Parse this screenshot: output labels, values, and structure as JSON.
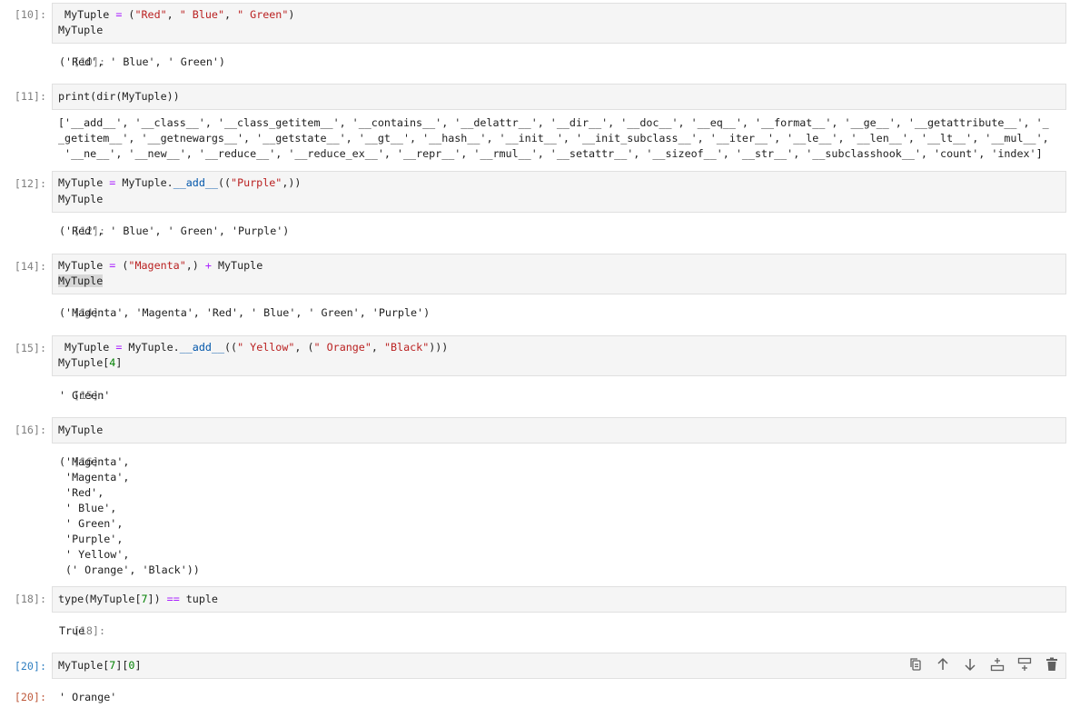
{
  "cells": [
    {
      "in_prompt": "[10]:",
      "code": [
        " MyTuple = (\"Red\", \" Blue\", \" Green\")",
        "MyTuple"
      ],
      "out_prompt": "[10]:",
      "output": [
        "('Red', ' Blue', ' Green')"
      ]
    },
    {
      "in_prompt": "[11]:",
      "code": [
        "print(dir(MyTuple))"
      ],
      "output": [
        "['__add__', '__class__', '__class_getitem__', '__contains__', '__delattr__', '__dir__', '__doc__', '__eq__', '__format__', '__ge__', '__getattribute__', '_",
        "_getitem__', '__getnewargs__', '__getstate__', '__gt__', '__hash__', '__init__', '__init_subclass__', '__iter__', '__le__', '__len__', '__lt__', '__mul__',",
        " '__ne__', '__new__', '__reduce__', '__reduce_ex__', '__repr__', '__rmul__', '__setattr__', '__sizeof__', '__str__', '__subclasshook__', 'count', 'index']"
      ]
    },
    {
      "in_prompt": "[12]:",
      "code": [
        "MyTuple = MyTuple.__add__((\"Purple\",))",
        "MyTuple"
      ],
      "out_prompt": "[12]:",
      "output": [
        "('Red', ' Blue', ' Green', 'Purple')"
      ]
    },
    {
      "in_prompt": "[14]:",
      "code": [
        "MyTuple = (\"Magenta\",) + MyTuple",
        "MyTuple"
      ],
      "out_prompt": "[14]:",
      "output": [
        "('Magenta', 'Magenta', 'Red', ' Blue', ' Green', 'Purple')"
      ]
    },
    {
      "in_prompt": "[15]:",
      "code": [
        " MyTuple = MyTuple.__add__((\" Yellow\", (\" Orange\", \"Black\")))",
        "MyTuple[4]"
      ],
      "out_prompt": "[15]:",
      "output": [
        "' Green'"
      ]
    },
    {
      "in_prompt": "[16]:",
      "code": [
        "MyTuple"
      ],
      "out_prompt": "[16]:",
      "output": [
        "('Magenta',",
        " 'Magenta',",
        " 'Red',",
        " ' Blue',",
        " ' Green',",
        " 'Purple',",
        " ' Yellow',",
        " (' Orange', 'Black'))"
      ]
    },
    {
      "in_prompt": "[18]:",
      "code": [
        "type(MyTuple[7]) == tuple"
      ],
      "out_prompt": "[18]:",
      "output": [
        "True"
      ]
    },
    {
      "in_prompt": "[20]:",
      "code": [
        "MyTuple[7][0]"
      ],
      "out_prompt": "[20]:",
      "output": [
        "' Orange'"
      ]
    }
  ],
  "toolbar": [
    "copy-icon",
    "move-up-icon",
    "move-down-icon",
    "insert-below-icon",
    "insert-above-icon",
    "delete-icon"
  ],
  "colors": {
    "active_prompt": "#307fc1",
    "active_output_prompt": "#bf5b3d",
    "string": "#ba2121",
    "operator": "#aa22ff"
  }
}
